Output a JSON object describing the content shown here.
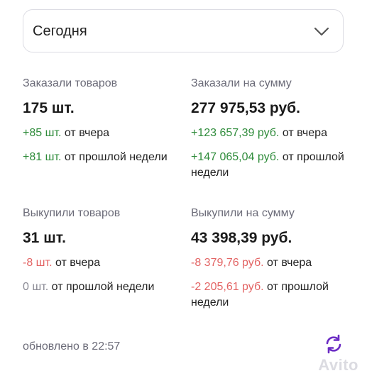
{
  "period": {
    "selected": "Сегодня",
    "icon": "chevron-down-icon"
  },
  "ordered_goods": {
    "label": "Заказали товаров",
    "value": "175 шт.",
    "vs_yesterday": {
      "delta": "+85 шт.",
      "suffix": "от вчера"
    },
    "vs_last_week": {
      "delta": "+81 шт.",
      "suffix": "от прошлой недели"
    }
  },
  "ordered_sum": {
    "label": "Заказали на сумму",
    "value": "277 975,53 руб.",
    "vs_yesterday": {
      "delta": "+123 657,39 руб.",
      "suffix": "от вчера"
    },
    "vs_last_week": {
      "delta": "+147 065,04 руб.",
      "suffix": "от прошлой недели"
    }
  },
  "bought_goods": {
    "label": "Выкупили товаров",
    "value": "31 шт.",
    "vs_yesterday": {
      "delta": "-8 шт.",
      "suffix": "от вчера"
    },
    "vs_last_week": {
      "delta": "0 шт.",
      "suffix": "от прошлой недели"
    }
  },
  "bought_sum": {
    "label": "Выкупили на сумму",
    "value": "43 398,39 руб.",
    "vs_yesterday": {
      "delta": "-8 379,76 руб.",
      "suffix": "от вчера"
    },
    "vs_last_week": {
      "delta": "-2 205,61 руб.",
      "suffix": "от прошлой недели"
    }
  },
  "footer": {
    "updated_text": "обновлено в 22:57",
    "refresh_icon": "refresh-icon",
    "refresh_color": "#6b2cc4"
  },
  "watermark": "Avito",
  "colors": {
    "positive": "#2e8b3a",
    "negative": "#e36464",
    "neutral": "#8a8a94"
  }
}
